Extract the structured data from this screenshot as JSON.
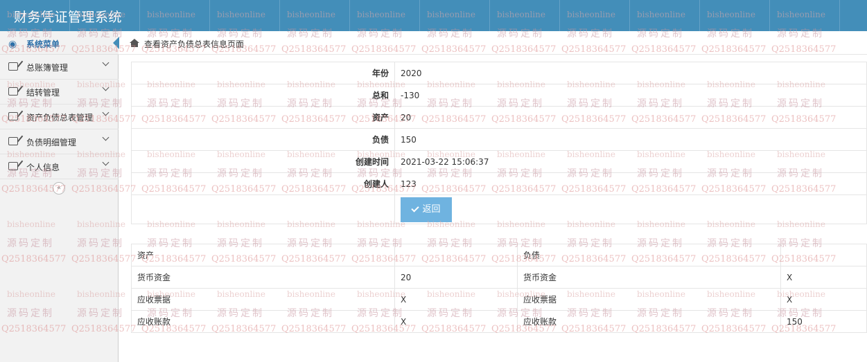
{
  "app": {
    "title": "财务凭证管理系统"
  },
  "sidebar": {
    "menu_label": "系统菜单",
    "items": [
      {
        "label": "总账簿管理"
      },
      {
        "label": "结转管理"
      },
      {
        "label": "资产负债总表管理"
      },
      {
        "label": "负债明细管理"
      },
      {
        "label": "个人信息"
      }
    ],
    "collapse_glyph": "«"
  },
  "breadcrumb": {
    "text": "查看资产负债总表信息页面"
  },
  "detail": {
    "rows": [
      {
        "label": "年份",
        "value": "2020"
      },
      {
        "label": "总和",
        "value": "-130"
      },
      {
        "label": "资产",
        "value": "20"
      },
      {
        "label": "负债",
        "value": "150"
      },
      {
        "label": "创建时间",
        "value": "2021-03-22 15:06:37"
      },
      {
        "label": "创建人",
        "value": "123"
      }
    ],
    "back_button": "返回"
  },
  "balance": {
    "header": [
      "资产",
      "",
      "负债",
      ""
    ],
    "rows": [
      [
        "货币资金",
        "20",
        "货币资金",
        "X"
      ],
      [
        "应收票据",
        "X",
        "应收票据",
        "X"
      ],
      [
        "应收账款",
        "X",
        "应收账款",
        "150"
      ]
    ]
  },
  "watermark": {
    "line1": "bisheonline",
    "line2": "源码定制",
    "line3": "Q2518364577"
  },
  "colors": {
    "header": "#438eb9",
    "accent": "#2b6fa8",
    "button": "#6fb3e0",
    "sidebar": "#f2f2f2"
  }
}
